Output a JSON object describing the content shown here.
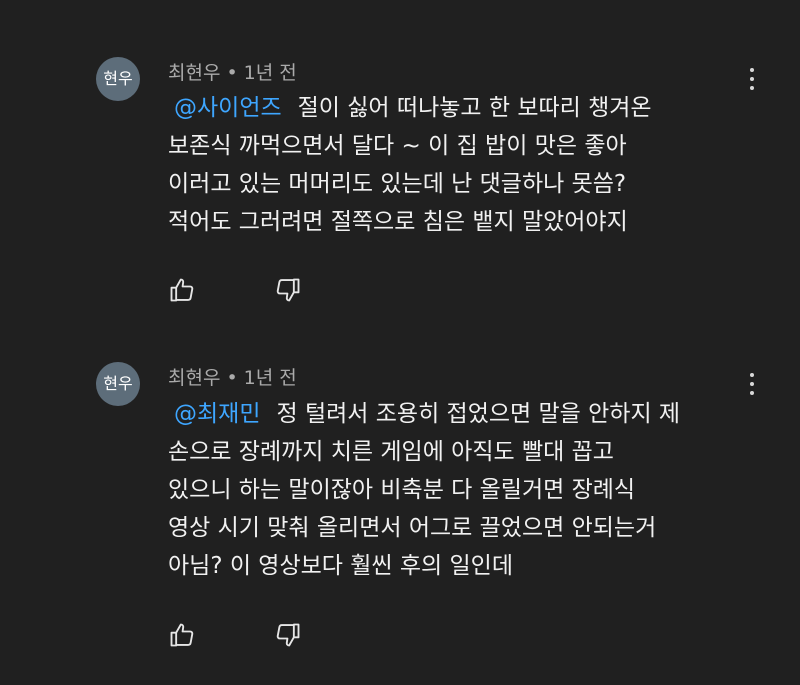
{
  "comments": [
    {
      "avatar_text": "현우",
      "author": "최현우",
      "separator": "•",
      "time": "1년 전",
      "mention": "@사이언즈",
      "lines": [
        "절이 싫어 떠나놓고 한 보따리 챙겨온",
        "보존식 까먹으면서 달다 ~ 이 집 밥이 맛은 좋아",
        "이러고 있는 머머리도 있는데 난 댓글하나 못씀?",
        "적어도 그러려면 절쪽으로 침은 뱉지 말았어야지"
      ]
    },
    {
      "avatar_text": "현우",
      "author": "최현우",
      "separator": "•",
      "time": "1년 전",
      "mention": "@최재민",
      "lines": [
        "정 털려서 조용히 접었으면 말을 안하지 제",
        "손으로 장례까지 치른 게임에 아직도 빨대 꼽고",
        "있으니 하는 말이잖아 비축분 다 올릴거면 장례식",
        "영상 시기 맞춰 올리면서 어그로 끌었으면 안되는거",
        "아님? 이 영상보다 훨씬 후의 일인데"
      ]
    }
  ],
  "icons": {
    "like": "thumbs-up-icon",
    "dislike": "thumbs-down-icon",
    "menu": "more-vert-icon"
  },
  "colors": {
    "background": "#202020",
    "text": "#f1f1f1",
    "meta": "#aaaaaa",
    "mention": "#3ea6ff",
    "avatar": "#5d6d7a"
  }
}
